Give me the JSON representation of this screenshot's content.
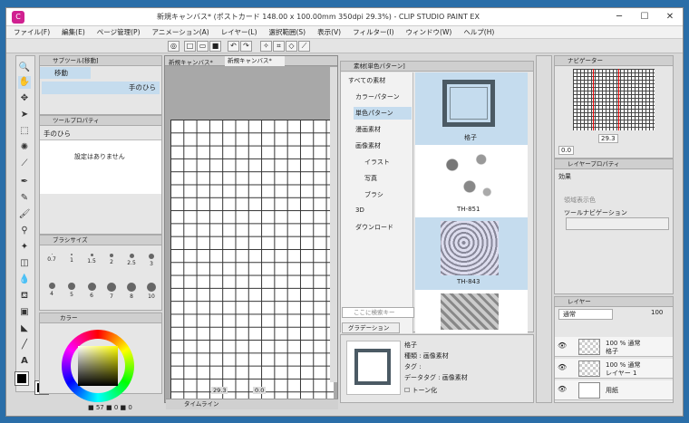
{
  "window": {
    "title": "新規キャンバス* (ポストカード 148.00 x 100.00mm 350dpi 29.3%) - CLIP STUDIO PAINT EX",
    "minimize": "─",
    "maximize": "☐",
    "close": "✕"
  },
  "menu": [
    "ファイル(F)",
    "編集(E)",
    "ページ管理(P)",
    "アニメーション(A)",
    "レイヤー(L)",
    "選択範囲(S)",
    "表示(V)",
    "フィルター(I)",
    "ウィンドウ(W)",
    "ヘルプ(H)"
  ],
  "subtool": {
    "title": "サブツール[移動]",
    "active": "移動",
    "item": "手のひら"
  },
  "toolprop": {
    "title": "ツールプロパティ",
    "name": "手のひら",
    "empty": "設定はありません"
  },
  "brushsize": {
    "title": "ブラシサイズ",
    "sizes": [
      "0.7",
      "1",
      "1.5",
      "2",
      "2.5",
      "3",
      "4",
      "5",
      "6",
      "7",
      "8",
      "10"
    ]
  },
  "color": {
    "title": "カラー",
    "readout": [
      "57",
      "0",
      "0"
    ]
  },
  "canvas": {
    "tabs": [
      "新規キャンバス*",
      "新規キャンバス*"
    ],
    "zoom": "29.3",
    "angle": "0.0",
    "timeline": "タイムライン"
  },
  "material": {
    "title": "素材[単色パターン]",
    "tree": [
      "すべての素材",
      "カラーパターン",
      "単色パターン",
      "漫画素材",
      "画像素材",
      "イラスト",
      "写真",
      "ブラシ",
      "3D",
      "ダウンロード"
    ],
    "items": [
      "格子",
      "TH-851",
      "TH-843"
    ],
    "search_placeholder": "ここに検索キー",
    "gradation": "グラデーション",
    "detail": {
      "name": "格子",
      "kind": "種類 : 画像素材",
      "tag": "タグ :",
      "datatag": "データタグ : 画像素材",
      "tone": "トーン化"
    }
  },
  "navigator": {
    "title": "ナビゲーター",
    "zoom": "29.3",
    "angle": "0.0"
  },
  "layerprop": {
    "title": "レイヤープロパティ",
    "effect": "効果",
    "area": "領域表示色",
    "tool_nav": "ツールナビゲーション"
  },
  "layers": {
    "title": "レイヤー",
    "blend": "通常",
    "opacity": "100",
    "rows": [
      {
        "line1": "100 % 通常",
        "line2": "格子"
      },
      {
        "line1": "100 % 通常",
        "line2": "レイヤー 1"
      },
      {
        "line1": "",
        "line2": "用紙"
      }
    ]
  }
}
